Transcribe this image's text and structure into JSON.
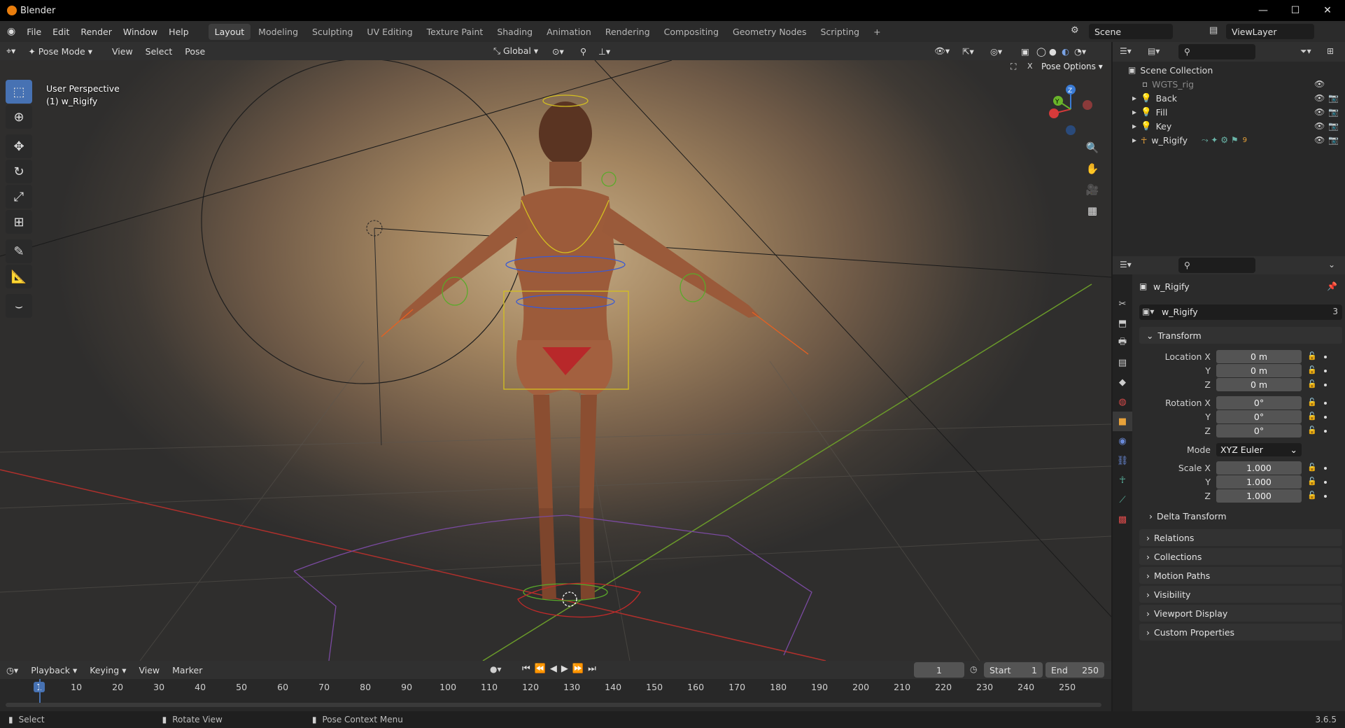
{
  "window": {
    "title": "Blender"
  },
  "menu": [
    "File",
    "Edit",
    "Render",
    "Window",
    "Help"
  ],
  "workspaces": [
    "Layout",
    "Modeling",
    "Sculpting",
    "UV Editing",
    "Texture Paint",
    "Shading",
    "Animation",
    "Rendering",
    "Compositing",
    "Geometry Nodes",
    "Scripting"
  ],
  "active_workspace": "Layout",
  "scene": {
    "label": "Scene"
  },
  "view_layer": {
    "label": "ViewLayer"
  },
  "viewport_header": {
    "mode": "Pose Mode",
    "menus": [
      "View",
      "Select",
      "Pose"
    ],
    "transform_orientation": "Global"
  },
  "viewport": {
    "perspective": "User Perspective",
    "object_line": "(1) w_Rigify",
    "pose_options": "Pose Options"
  },
  "outliner": {
    "root": "Scene Collection",
    "items": [
      {
        "name": "WGTS_rig"
      },
      {
        "name": "Back"
      },
      {
        "name": "Fill"
      },
      {
        "name": "Key"
      },
      {
        "name": "w_Rigify",
        "extra": "9"
      }
    ]
  },
  "properties": {
    "object_name": "w_Rigify",
    "datablock_name": "w_Rigify",
    "user_count": "3",
    "transform_label": "Transform",
    "location": {
      "label": "Location X",
      "x": "0 m",
      "y": "0 m",
      "z": "0 m"
    },
    "rotation": {
      "label": "Rotation X",
      "x": "0°",
      "y": "0°",
      "z": "0°"
    },
    "mode_label": "Mode",
    "mode_value": "XYZ Euler",
    "scale": {
      "label": "Scale X",
      "x": "1.000",
      "y": "1.000",
      "z": "1.000"
    },
    "axis_y": "Y",
    "axis_z": "Z",
    "subpanels": [
      "Delta Transform"
    ],
    "panels": [
      "Relations",
      "Collections",
      "Motion Paths",
      "Visibility",
      "Viewport Display",
      "Custom Properties"
    ]
  },
  "timeline": {
    "menus": [
      "Playback",
      "Keying",
      "View",
      "Marker"
    ],
    "current_frame": "1",
    "start_label": "Start",
    "start": "1",
    "end_label": "End",
    "end": "250",
    "ticks": [
      "1",
      "10",
      "20",
      "30",
      "40",
      "50",
      "60",
      "70",
      "80",
      "90",
      "100",
      "110",
      "120",
      "130",
      "140",
      "150",
      "160",
      "170",
      "180",
      "190",
      "200",
      "210",
      "220",
      "230",
      "240",
      "250"
    ]
  },
  "statusbar": {
    "select": "Select",
    "rotate": "Rotate View",
    "context": "Pose Context Menu",
    "version": "3.6.5"
  },
  "colors": {
    "accent": "#4772b3",
    "active_frame": "#4772b3",
    "brand": "#e87d0d"
  }
}
